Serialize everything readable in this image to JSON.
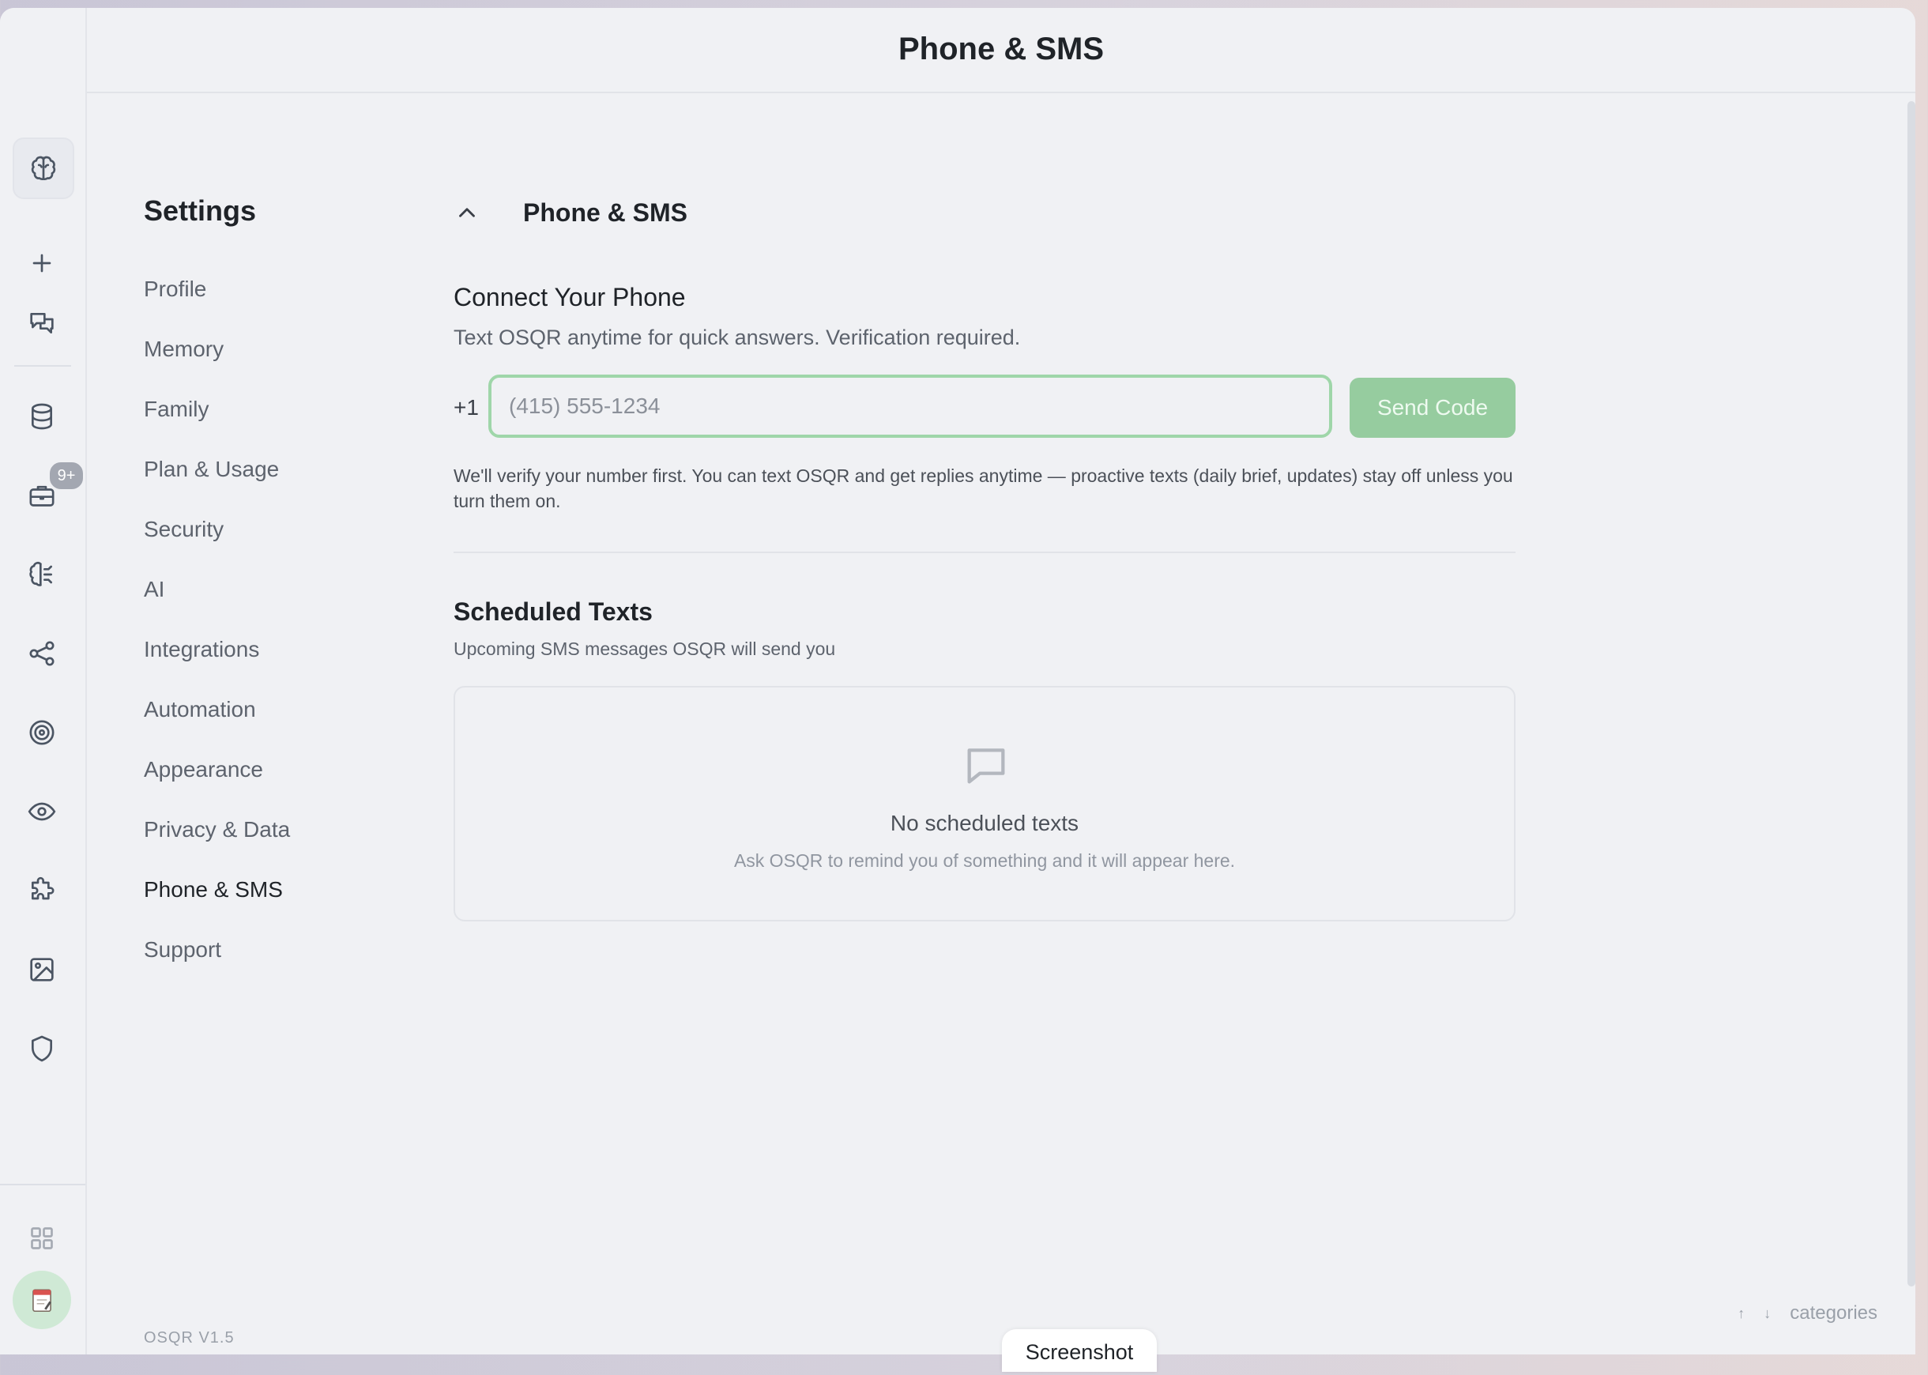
{
  "header": {
    "title": "Phone & SMS"
  },
  "rail": {
    "badge": "9+",
    "icons": [
      "brain-icon",
      "plus-icon",
      "chat-icon",
      "database-icon",
      "briefcase-icon",
      "brain-circuit-icon",
      "share-icon",
      "target-icon",
      "eye-icon",
      "puzzle-icon",
      "image-icon",
      "shield-icon",
      "grid-icon",
      "notepad-avatar-icon"
    ]
  },
  "settings": {
    "title": "Settings",
    "nav": [
      {
        "label": "Profile"
      },
      {
        "label": "Memory"
      },
      {
        "label": "Family"
      },
      {
        "label": "Plan & Usage"
      },
      {
        "label": "Security"
      },
      {
        "label": "AI"
      },
      {
        "label": "Integrations"
      },
      {
        "label": "Automation"
      },
      {
        "label": "Appearance"
      },
      {
        "label": "Privacy & Data"
      },
      {
        "label": "Phone & SMS",
        "active": true
      },
      {
        "label": "Support"
      }
    ],
    "version": "OSQR V1.5"
  },
  "main": {
    "section_title": "Phone & SMS",
    "connect": {
      "title": "Connect Your Phone",
      "subtitle": "Text OSQR anytime for quick answers. Verification required.",
      "country_code": "+1",
      "phone_placeholder": "(415) 555-1234",
      "phone_value": "",
      "send_label": "Send Code",
      "note": "We'll verify your number first. You can text OSQR and get replies anytime — proactive texts (daily brief, updates) stay off unless you turn them on."
    },
    "scheduled": {
      "title": "Scheduled Texts",
      "subtitle": "Upcoming SMS messages OSQR will send you",
      "empty_title": "No scheduled texts",
      "empty_subtitle": "Ask OSQR to remind you of something and it will appear here."
    }
  },
  "footer": {
    "hint_up": "↑",
    "hint_down": "↓",
    "hint_label": "categories",
    "screenshot_label": "Screenshot"
  },
  "colors": {
    "accent_green": "#9fd6a9",
    "button_green": "#96cc9f",
    "background": "#f0f1f4"
  }
}
